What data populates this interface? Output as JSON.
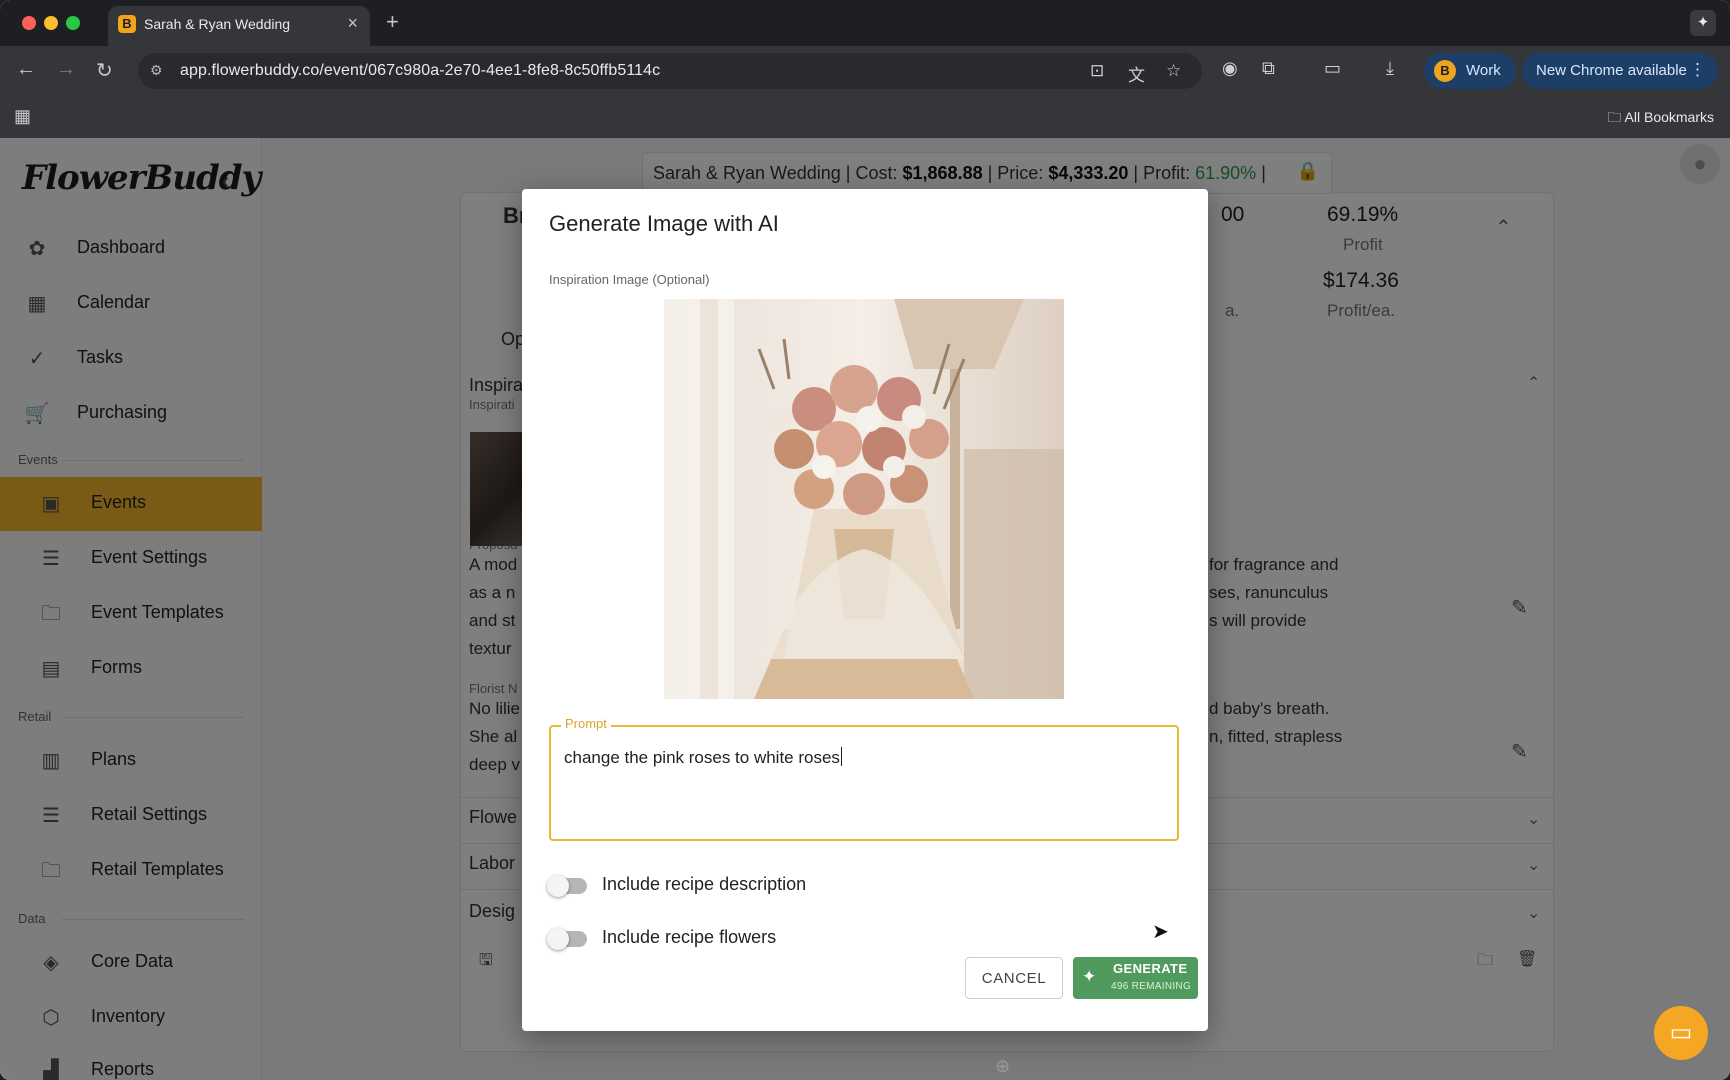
{
  "browser": {
    "tab_title": "Sarah & Ryan Wedding",
    "tab_favicon": "B",
    "url": "app.flowerbuddy.co/event/067c980a-2e70-4ee1-8fe8-8c50ffb5114c",
    "profile_initial": "B",
    "profile_label": "Work",
    "update_label": "New Chrome available",
    "bookmarks_label": "All Bookmarks"
  },
  "sidebar": {
    "logo": "FlowerBuddy",
    "items": [
      {
        "label": "Dashboard",
        "icon": "flower-icon"
      },
      {
        "label": "Calendar",
        "icon": "calendar-icon"
      },
      {
        "label": "Tasks",
        "icon": "check-circle-icon"
      },
      {
        "label": "Purchasing",
        "icon": "cart-icon"
      }
    ],
    "section_events": "Events",
    "events_items": [
      {
        "label": "Events",
        "icon": "event-icon"
      },
      {
        "label": "Event Settings",
        "icon": "sliders-icon"
      },
      {
        "label": "Event Templates",
        "icon": "folder-icon"
      },
      {
        "label": "Forms",
        "icon": "list-icon"
      }
    ],
    "section_retail": "Retail",
    "retail_items": [
      {
        "label": "Plans",
        "icon": "store-icon"
      },
      {
        "label": "Retail Settings",
        "icon": "sliders-icon"
      },
      {
        "label": "Retail Templates",
        "icon": "folder-icon"
      }
    ],
    "section_data": "Data",
    "data_items": [
      {
        "label": "Core Data",
        "icon": "layers-icon"
      },
      {
        "label": "Inventory",
        "icon": "box-icon"
      },
      {
        "label": "Reports",
        "icon": "chart-icon"
      }
    ]
  },
  "summary": {
    "event": "Sarah & Ryan Wedding |",
    "cost_label": "Cost:",
    "cost": "$1,868.88",
    "price_label": "| Price:",
    "price": "$4,333.20",
    "profit_label": "| Profit:",
    "profit": "61.90%",
    "end": "|"
  },
  "background": {
    "card_title_frag": "Br",
    "stat_frag": "00",
    "profit_pct": "69.19%",
    "profit_label": "Profit",
    "profit_each": "$174.36",
    "profit_each_label": "Profit/ea.",
    "ea_frag": "a.",
    "op_frag": "Op",
    "inspira_head": "Inspira",
    "inspira_small": "Inspirati",
    "proposal_small": "Proposa",
    "proposal_left": [
      "A mod",
      "as a n",
      "and st",
      "textur"
    ],
    "proposal_right": [
      "for fragrance and",
      "ses, ranunculus",
      "s will provide"
    ],
    "florist_small": "Florist N",
    "florist_left": [
      "No lilie",
      "She al",
      "deep v"
    ],
    "florist_right": [
      "d baby's breath.",
      "n, fitted, strapless"
    ],
    "flowers_head": "Flowe",
    "labor_head": "Labor",
    "design_head": "Desig"
  },
  "modal": {
    "title": "Generate Image with AI",
    "inspiration_label": "Inspiration Image (Optional)",
    "prompt_legend": "Prompt",
    "prompt_value": "change the pink roses to white roses",
    "toggle_description": "Include recipe description",
    "toggle_flowers": "Include recipe flowers",
    "cancel": "CANCEL",
    "generate": "GENERATE",
    "remaining": "496 REMAINING"
  },
  "colors": {
    "accent": "#f5b62c",
    "generate": "#4f9a5c",
    "profit_green": "#2e9b4a"
  }
}
